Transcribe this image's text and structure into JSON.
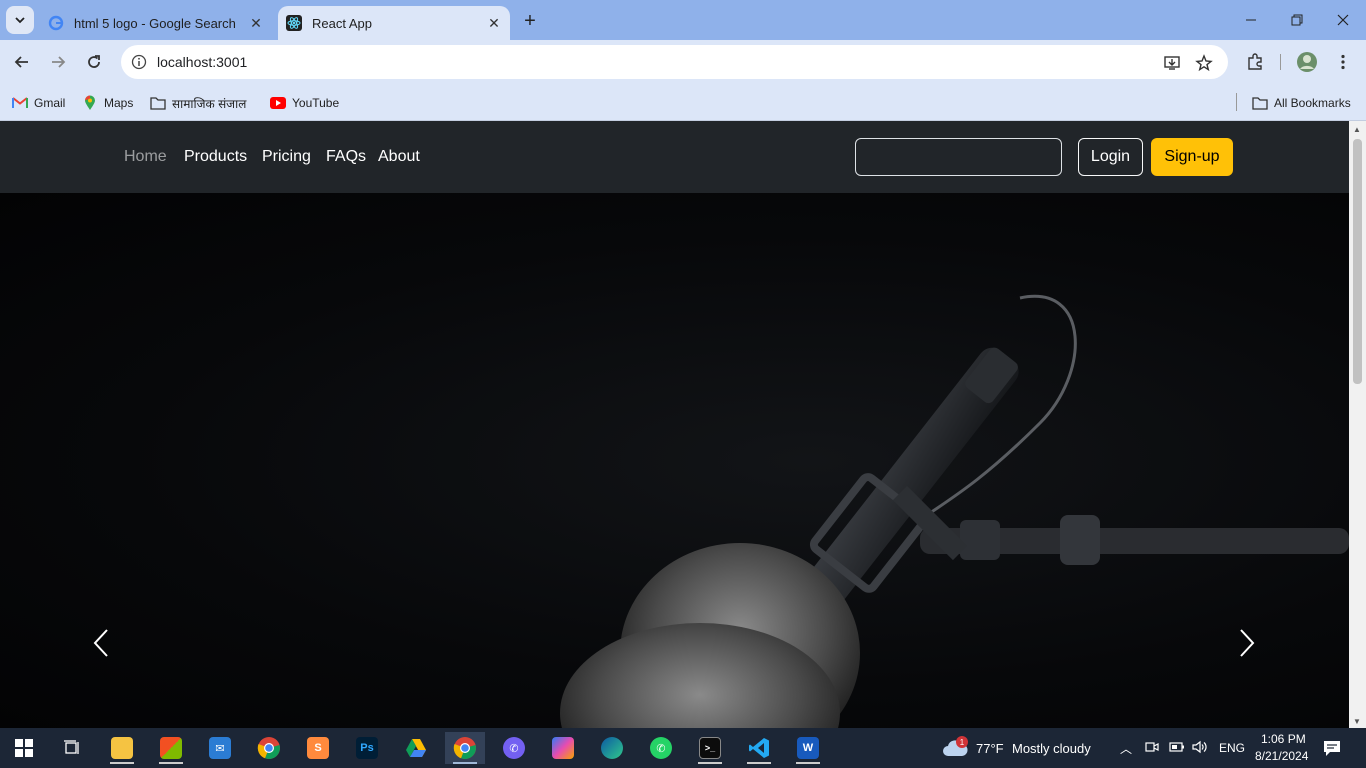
{
  "browser": {
    "tabs": [
      {
        "title": "html 5 logo - Google Search",
        "active": false
      },
      {
        "title": "React App",
        "active": true
      }
    ],
    "url": "localhost:3001",
    "bookmarks": [
      {
        "label": "Gmail"
      },
      {
        "label": "Maps"
      },
      {
        "label": "सामाजिक संजाल"
      },
      {
        "label": "YouTube"
      }
    ],
    "all_bookmarks": "All Bookmarks"
  },
  "navbar": {
    "links": [
      "Home",
      "Products",
      "Pricing",
      "FAQs",
      "About"
    ],
    "search_placeholder": "",
    "login_label": "Login",
    "signup_label": "Sign-up",
    "accent_color": "#ffc107"
  },
  "carousel": {
    "prev_icon": "chevron-left-icon",
    "next_icon": "chevron-right-icon",
    "image": "microphone-with-fur-windscreen"
  },
  "taskbar": {
    "weather_temp": "77°F",
    "weather_desc": "Mostly cloudy",
    "weather_badge": "1",
    "language": "ENG",
    "time": "1:06 PM",
    "date": "8/21/2024",
    "apps": [
      "start",
      "task-view",
      "file-explorer",
      "microsoft-store",
      "mail",
      "chrome",
      "sublime",
      "photoshop",
      "google-drive",
      "chrome-active",
      "viber",
      "copilot",
      "edge",
      "whatsapp",
      "terminal",
      "vscode",
      "word"
    ]
  }
}
